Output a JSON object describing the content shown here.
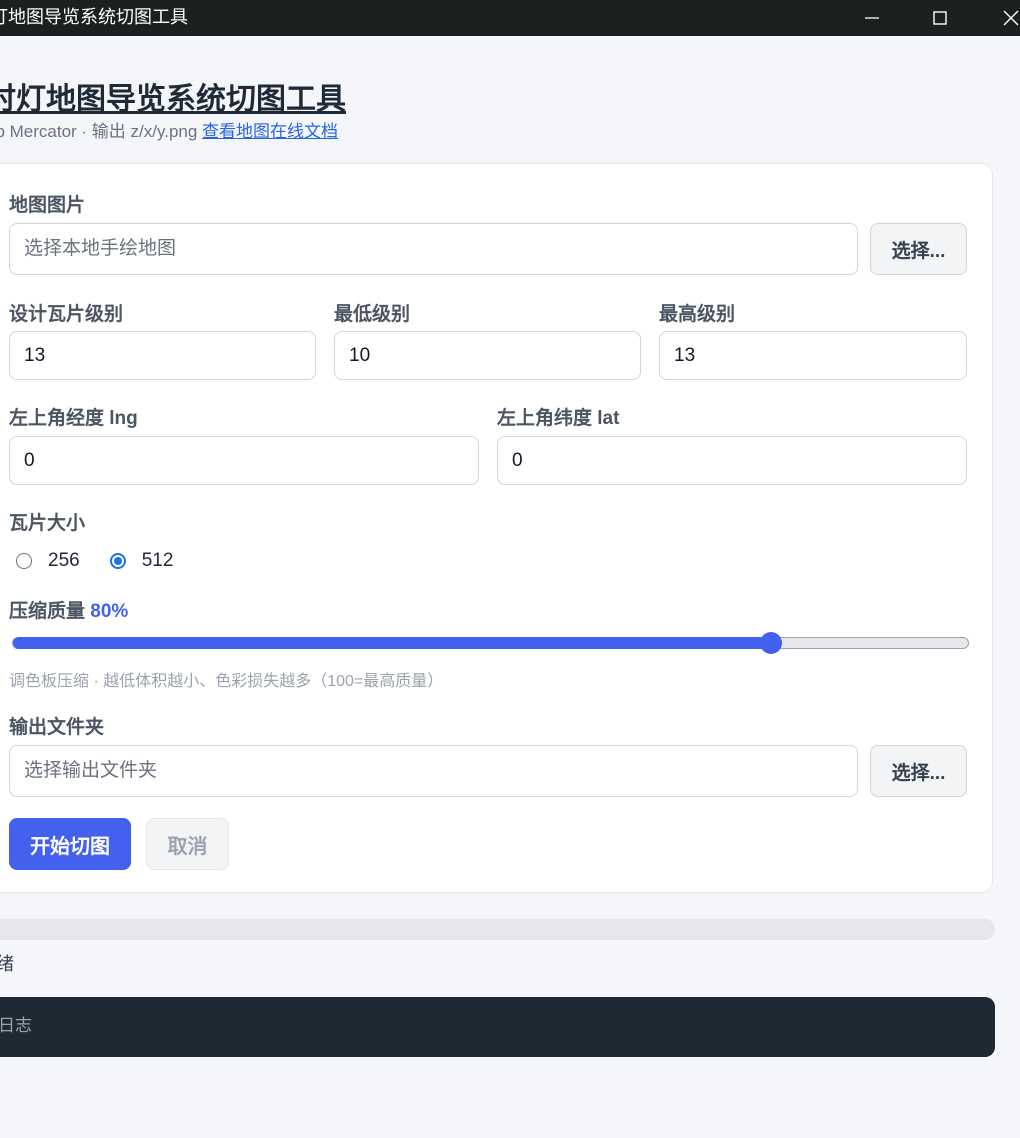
{
  "window": {
    "title": "灯地图导览系统切图工具"
  },
  "header": {
    "title": "时灯地图导览系统切图工具",
    "subtitle": "eb Mercator · 输出 z/x/y.png",
    "doc_link": "查看地图在线文档"
  },
  "form": {
    "map_image": {
      "label": "地图图片",
      "placeholder": "选择本地手绘地图",
      "value": "",
      "button": "选择..."
    },
    "design_level": {
      "label": "设计瓦片级别",
      "value": "13"
    },
    "min_level": {
      "label": "最低级别",
      "value": "10"
    },
    "max_level": {
      "label": "最高级别",
      "value": "13"
    },
    "top_left_lng": {
      "label": "左上角经度 lng",
      "value": "0"
    },
    "top_left_lat": {
      "label": "左上角纬度 lat",
      "value": "0"
    },
    "tile_size": {
      "label": "瓦片大小",
      "options": [
        "256",
        "512"
      ],
      "selected": "512"
    },
    "quality": {
      "label": "压缩质量",
      "display": "80%",
      "percent": 80,
      "hint": "调色板压缩 · 越低体积越小、色彩损失越多（100=最高质量）"
    },
    "output_folder": {
      "label": "输出文件夹",
      "placeholder": "选择输出文件夹",
      "value": "",
      "button": "选择..."
    },
    "start_button": "开始切图",
    "cancel_button": "取消"
  },
  "progress": {
    "fraction": 0
  },
  "status": {
    "text": "绪"
  },
  "log": {
    "placeholder": "日志"
  },
  "colors": {
    "accent": "#4361ee",
    "titlebar": "#1c211e",
    "log_bg": "#1f2933"
  }
}
